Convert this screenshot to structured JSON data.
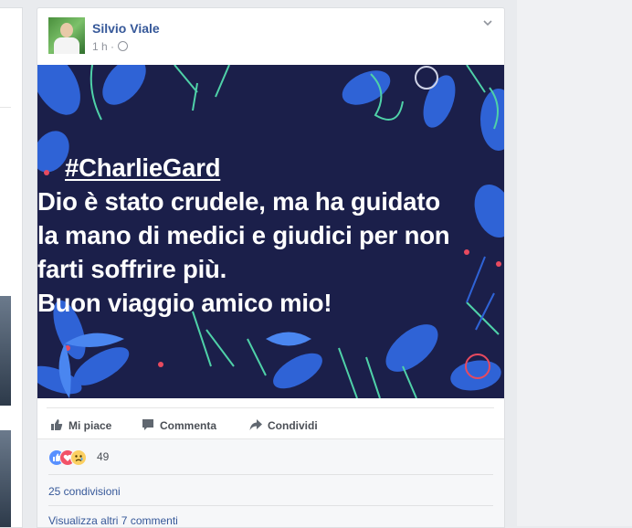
{
  "post": {
    "author": "Silvio Viale",
    "time": "1 h",
    "time_separator": "·",
    "privacy_icon": "globe-icon",
    "menu_icon": "chevron-down-icon",
    "image_text": {
      "hashtag": "#CharlieGard",
      "lines": [
        "Dio è stato crudele, ma ha guidato",
        "la mano di medici e giudici per non",
        "farti soffrire più.",
        "Buon viaggio amico mio!"
      ]
    },
    "colors": {
      "image_background": "#1b1f4a",
      "leaf_blue": "#2f63d6",
      "leaf_light": "#4a86f0",
      "stem_green": "#4fd1a8",
      "berry_red": "#e84a5f",
      "link": "#365899"
    }
  },
  "actions": {
    "like": "Mi piace",
    "comment": "Commenta",
    "share": "Condividi"
  },
  "feedback": {
    "reaction_icons": [
      "like-icon",
      "love-icon",
      "sad-icon"
    ],
    "reactions_count": "49",
    "shares": "25 condivisioni",
    "more_comments": "Visualizza altri 7 commenti"
  }
}
